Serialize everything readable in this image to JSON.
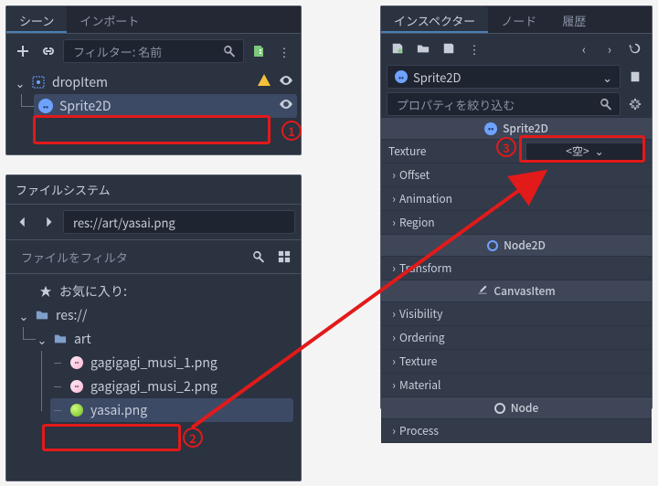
{
  "scene_panel": {
    "tabs": {
      "scene": "シーン",
      "import": "インポート"
    },
    "filter_placeholder": "フィルター: 名前",
    "nodes": {
      "root": "dropItem",
      "child": "Sprite2D"
    }
  },
  "filesystem_panel": {
    "title": "ファイルシステム",
    "path": "res://art/yasai.png",
    "filter_placeholder": "ファイルをフィルタ",
    "favorites": "お気に入り:",
    "root": "res://",
    "folder": "art",
    "files": [
      "gagigagi_musi_1.png",
      "gagigagi_musi_2.png",
      "yasai.png"
    ]
  },
  "inspector_panel": {
    "tabs": {
      "inspector": "インスペクター",
      "node": "ノード",
      "history": "履歴"
    },
    "object": "Sprite2D",
    "filter_placeholder": "プロパティを絞り込む",
    "sections": {
      "sprite2d": "Sprite2D",
      "node2d": "Node2D",
      "canvasitem": "CanvasItem",
      "node": "Node"
    },
    "props": {
      "texture_label": "Texture",
      "texture_value": "<空>",
      "offset": "Offset",
      "animation": "Animation",
      "region": "Region",
      "transform": "Transform",
      "visibility": "Visibility",
      "ordering": "Ordering",
      "texture2": "Texture",
      "material": "Material",
      "process": "Process"
    }
  },
  "callouts": {
    "c1": "1",
    "c2": "2",
    "c3": "3"
  }
}
